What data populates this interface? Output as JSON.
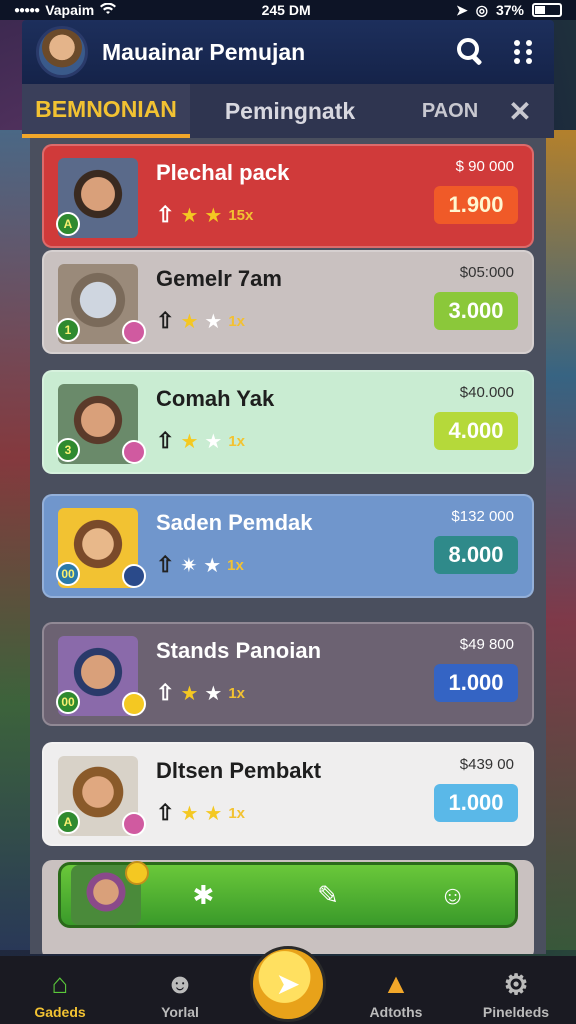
{
  "status": {
    "carrier": "Vapaim",
    "time": "245 DM",
    "battery": "37%"
  },
  "header": {
    "title": "Mauainar Pemujan"
  },
  "tabs": [
    {
      "label": "BEMNONIAN"
    },
    {
      "label": "Pemingnatk"
    },
    {
      "label": "PAON"
    }
  ],
  "cards": [
    {
      "name": "Plechal pack",
      "old_price": "$ 90 000",
      "price": "1.900",
      "level": "A",
      "mult": "15x"
    },
    {
      "name": "Gemelr 7am",
      "old_price": "$05:000",
      "price": "3.000",
      "level": "1",
      "mult": "1x"
    },
    {
      "name": "Comah Yak",
      "old_price": "$40.000",
      "price": "4.000",
      "level": "3",
      "mult": "1x"
    },
    {
      "name": "Saden Pemdak",
      "old_price": "$132 000",
      "price": "8.000",
      "level": "00",
      "mult": "1x"
    },
    {
      "name": "Stands Panoian",
      "old_price": "$49 800",
      "price": "1.000",
      "level": "00",
      "mult": "1x"
    },
    {
      "name": "Dltsen Pembakt",
      "old_price": "$439 00",
      "price": "1.000",
      "level": "A",
      "mult": "1x"
    }
  ],
  "nav": [
    {
      "label": "Gadeds",
      "icon": "home-icon"
    },
    {
      "label": "Yorlal",
      "icon": "profile-icon"
    },
    {
      "label": "Adtoths",
      "icon": "notification-icon"
    },
    {
      "label": "Pineldeds",
      "icon": "settings-icon"
    }
  ],
  "colors": {
    "header": "#1d2f5c",
    "tab_active": "#f2c232",
    "action_green": "#5ac83a"
  }
}
